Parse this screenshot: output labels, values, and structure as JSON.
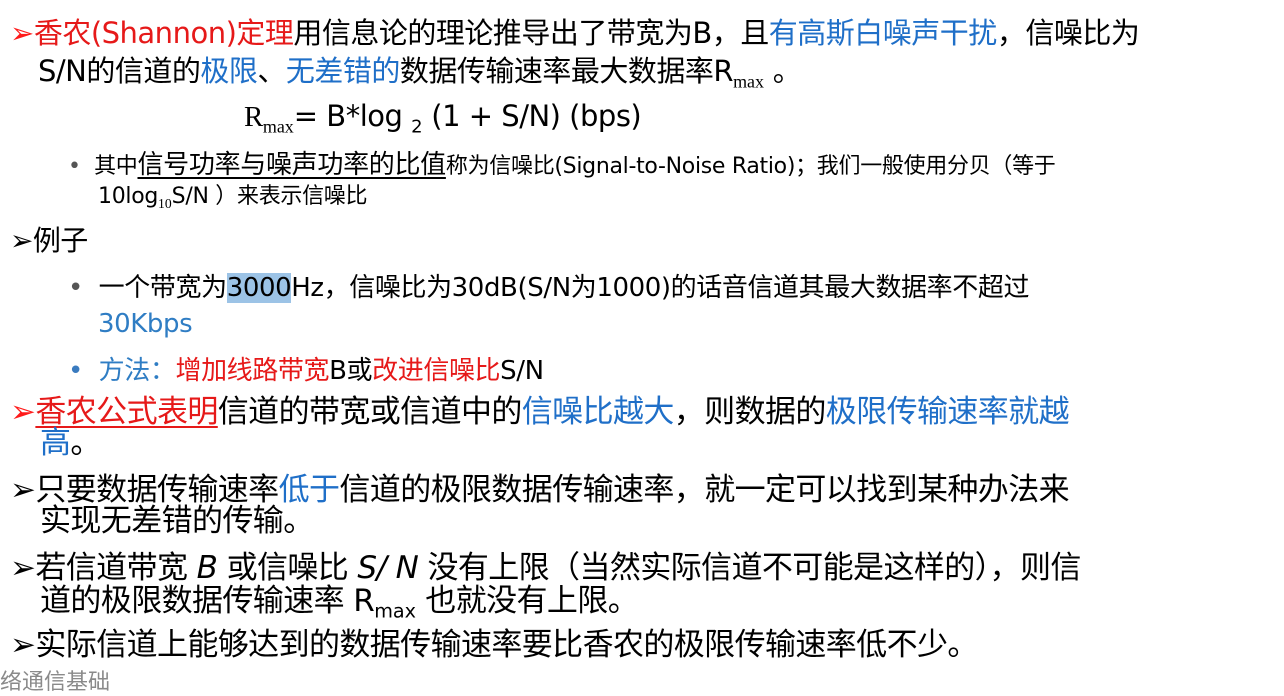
{
  "arrow": "➢",
  "bullet": "•",
  "p1": {
    "t1": "香农(Shannon)定理",
    "t2": "用信息论的理论推导出了带宽为B，且",
    "t3": "有高斯白噪声干扰",
    "t4": "，信噪比为",
    "t5": "S/N的信道的",
    "t6": "极限",
    "t7": "、",
    "t8": "无差错的",
    "t9": "数据传输速率最大数据率R",
    "t10": "max",
    "t11": " 。"
  },
  "formula": {
    "r": "R",
    "sub": "max",
    "t1": "= B*log ",
    "sub2": "2",
    "t2": " (1 + S/N)   (bps)"
  },
  "b1": {
    "t1": "其中",
    "t2": "信号功率与噪声功率的比值",
    "t3": "称为信噪比(Signal-to-Noise  Ratio)；我们一般使用分贝（等于",
    "t4": "10log",
    "sub": "10",
    "t5": "S/N ）来表示信噪比"
  },
  "p2": {
    "t1": "例子"
  },
  "b2": {
    "t1": "一个带宽为",
    "hl": "3000",
    "t2": "Hz，信噪比为30dB(S/N为1000)的话音信道其最大数据率不超过",
    "t3": "30Kbps"
  },
  "b3": {
    "t1": "方法：",
    "t2": "增加线路带宽",
    "t3": "B或",
    "t4": "改进信噪比",
    "t5": "S/N"
  },
  "p3": {
    "t1": "香农公式表明",
    "t2": "信道的带宽或信道中的",
    "t3": "信噪比越大",
    "t4": "，则数据的",
    "t5": "极限传输速率就越",
    "t6": "高",
    "t7": "。"
  },
  "p4": {
    "t1": "只要数据传输速率",
    "t2": "低于",
    "t3": "信道的极限数据传输速率，就一定可以找到某种办法来",
    "t4": "实现无差错的传输。"
  },
  "p5": {
    "t1": "若信道带宽 ",
    "t2": "B",
    "t3": " 或信噪比 ",
    "t4": "S/ N",
    "t5": " 没有上限（当然实际信道不可能是这样的），则信",
    "t6": "道的极限数据传输速率 R",
    "t7": "max",
    "t8": " 也就没有上限。"
  },
  "p6": {
    "t1": "实际信道上能够达到的数据传输速率要比香农的极限传输速率低不少。"
  },
  "footer": "络通信基础",
  "colors": {
    "red": "#e61919",
    "blue": "#1f6fc8",
    "highlight": "#9cc3e6"
  }
}
